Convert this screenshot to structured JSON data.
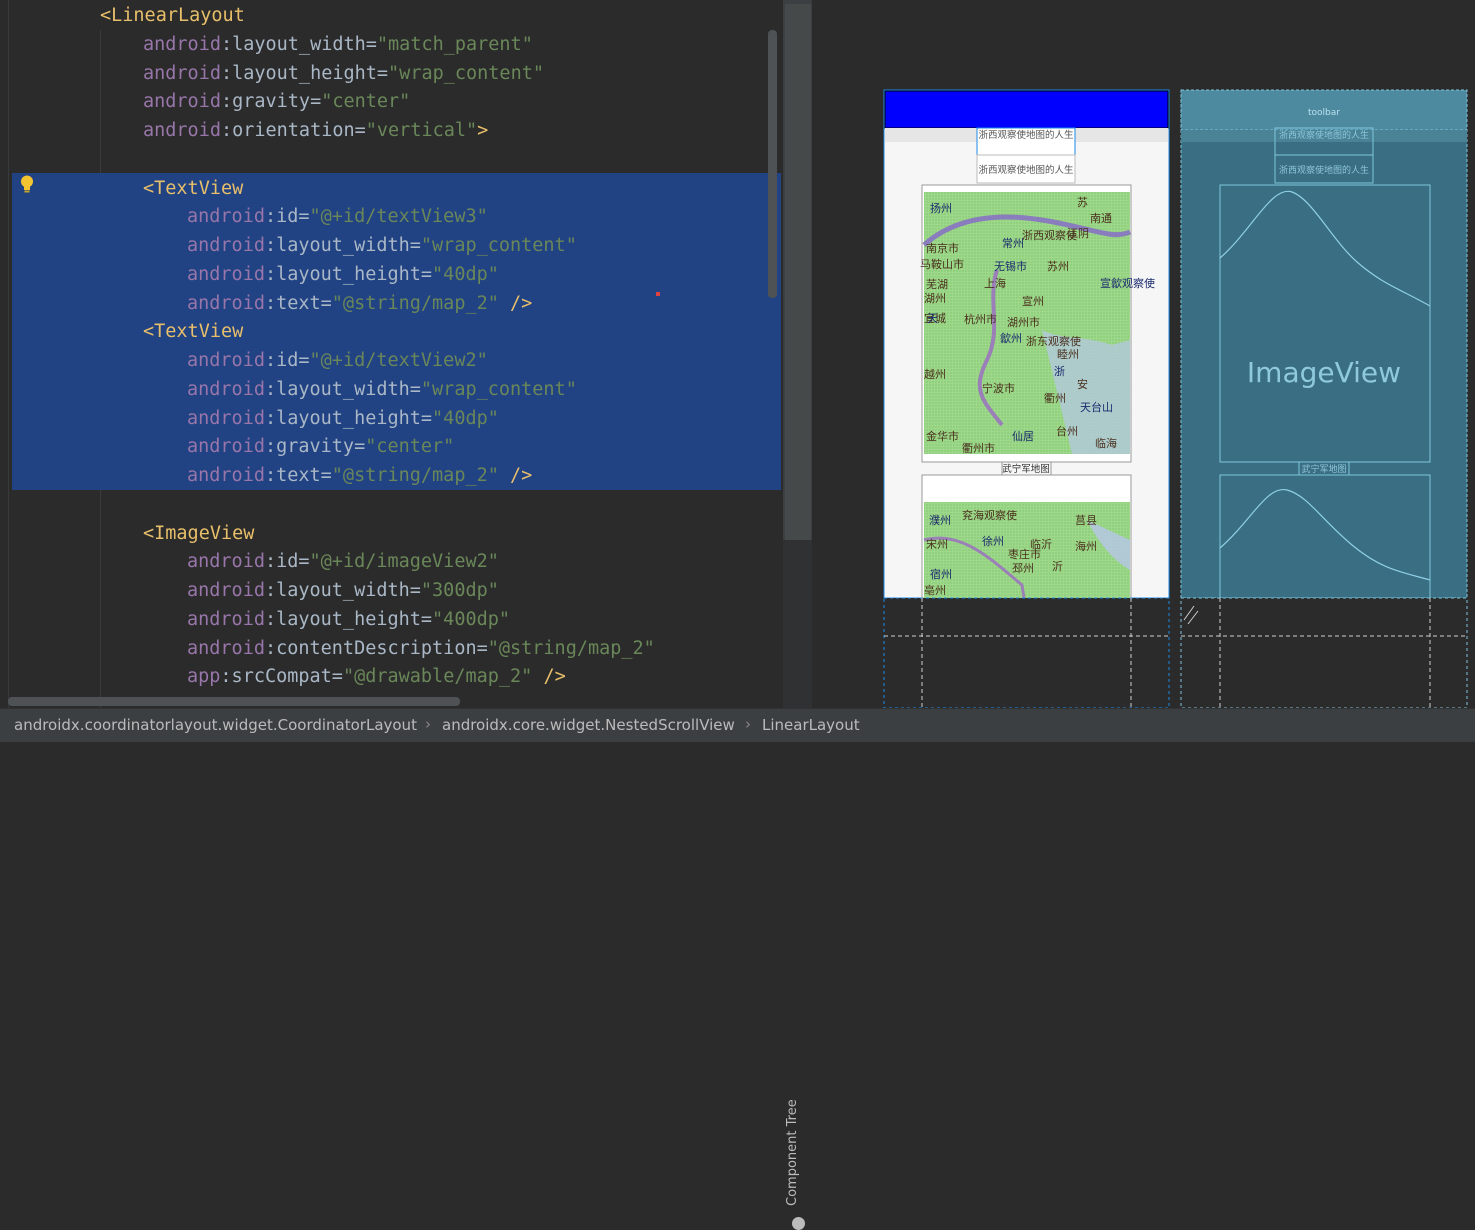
{
  "editor": {
    "lines": [
      {
        "indent": 0,
        "parts": [
          [
            "tag",
            "<LinearLayout"
          ]
        ]
      },
      {
        "indent": 1,
        "parts": [
          [
            "ns",
            "android"
          ],
          [
            "plain",
            ":layout_width="
          ],
          [
            "val",
            "\"match_parent\""
          ]
        ]
      },
      {
        "indent": 1,
        "parts": [
          [
            "ns",
            "android"
          ],
          [
            "plain",
            ":layout_height="
          ],
          [
            "val",
            "\"wrap_content\""
          ]
        ]
      },
      {
        "indent": 1,
        "parts": [
          [
            "ns",
            "android"
          ],
          [
            "plain",
            ":gravity="
          ],
          [
            "val",
            "\"center\""
          ]
        ]
      },
      {
        "indent": 1,
        "parts": [
          [
            "ns",
            "android"
          ],
          [
            "plain",
            ":orientation="
          ],
          [
            "val",
            "\"vertical\""
          ],
          [
            "tag",
            ">"
          ]
        ]
      },
      {
        "indent": 0,
        "parts": []
      },
      {
        "indent": 1,
        "parts": [
          [
            "tag",
            "<TextView"
          ]
        ]
      },
      {
        "indent": 2,
        "parts": [
          [
            "ns",
            "android"
          ],
          [
            "plain",
            ":id="
          ],
          [
            "val",
            "\"@+id/textView3\""
          ]
        ]
      },
      {
        "indent": 2,
        "parts": [
          [
            "ns",
            "android"
          ],
          [
            "plain",
            ":layout_width="
          ],
          [
            "val",
            "\"wrap_content\""
          ]
        ]
      },
      {
        "indent": 2,
        "parts": [
          [
            "ns",
            "android"
          ],
          [
            "plain",
            ":layout_height="
          ],
          [
            "val",
            "\"40dp\""
          ]
        ]
      },
      {
        "indent": 2,
        "parts": [
          [
            "ns",
            "android"
          ],
          [
            "plain",
            ":text="
          ],
          [
            "val",
            "\"@string/map_2\""
          ],
          [
            "tag",
            " />"
          ]
        ]
      },
      {
        "indent": 1,
        "parts": [
          [
            "tag",
            "<TextView"
          ]
        ]
      },
      {
        "indent": 2,
        "parts": [
          [
            "ns",
            "android"
          ],
          [
            "plain",
            ":id="
          ],
          [
            "val",
            "\"@+id/textView2\""
          ]
        ]
      },
      {
        "indent": 2,
        "parts": [
          [
            "ns",
            "android"
          ],
          [
            "plain",
            ":layout_width="
          ],
          [
            "val",
            "\"wrap_content\""
          ]
        ]
      },
      {
        "indent": 2,
        "parts": [
          [
            "ns",
            "android"
          ],
          [
            "plain",
            ":layout_height="
          ],
          [
            "val",
            "\"40dp\""
          ]
        ]
      },
      {
        "indent": 2,
        "parts": [
          [
            "ns",
            "android"
          ],
          [
            "plain",
            ":gravity="
          ],
          [
            "val",
            "\"center\""
          ]
        ]
      },
      {
        "indent": 2,
        "parts": [
          [
            "ns",
            "android"
          ],
          [
            "plain",
            ":text="
          ],
          [
            "val",
            "\"@string/map_2\""
          ],
          [
            "tag",
            " />"
          ]
        ]
      },
      {
        "indent": 0,
        "parts": []
      },
      {
        "indent": 1,
        "parts": [
          [
            "tag",
            "<ImageView"
          ]
        ]
      },
      {
        "indent": 2,
        "parts": [
          [
            "ns",
            "android"
          ],
          [
            "plain",
            ":id="
          ],
          [
            "val",
            "\"@+id/imageView2\""
          ]
        ]
      },
      {
        "indent": 2,
        "parts": [
          [
            "ns",
            "android"
          ],
          [
            "plain",
            ":layout_width="
          ],
          [
            "val",
            "\"300dp\""
          ]
        ]
      },
      {
        "indent": 2,
        "parts": [
          [
            "ns",
            "android"
          ],
          [
            "plain",
            ":layout_height="
          ],
          [
            "val",
            "\"400dp\""
          ]
        ]
      },
      {
        "indent": 2,
        "parts": [
          [
            "ns",
            "android"
          ],
          [
            "plain",
            ":contentDescription="
          ],
          [
            "val",
            "\"@string/map_2\""
          ]
        ]
      },
      {
        "indent": 2,
        "parts": [
          [
            "ns",
            "app"
          ],
          [
            "plain",
            ":srcCompat="
          ],
          [
            "val",
            "\"@drawable/map_2\""
          ],
          [
            "tag",
            " />"
          ]
        ]
      }
    ]
  },
  "side_panel": {
    "component_tree_label": "Component Tree"
  },
  "design": {
    "text1": "浙西观察使地图的人生",
    "text2": "浙西观察使地图的人生",
    "caption": "武宁军地图",
    "map_labels_1": [
      "扬州",
      "苏",
      "南通",
      "南京市",
      "常州",
      "浙西观察使",
      "江阴",
      "马鞍山市",
      "无锡市",
      "苏州",
      "芜湖",
      "上海",
      "宣歙观察使",
      "湖州",
      "宣州",
      "宜城",
      "天",
      "湖州市",
      "杭州市",
      "浙东观察使",
      "歙州",
      "睦州",
      "越州",
      "宁波市",
      "浙",
      "安",
      "衢州",
      "金华市",
      "仙居",
      "台州",
      "临海",
      "衢州市",
      "天台山"
    ],
    "map_labels_2": [
      "濮州",
      "兖海观察使",
      "莒县",
      "宋州",
      "徐州",
      "海州",
      "临沂",
      "枣庄市",
      "宿州",
      "沂",
      "亳州",
      "邳州"
    ]
  },
  "blueprint": {
    "toolbar_label": "toolbar",
    "imageview_label": "ImageView",
    "text1": "浙西观察使地图的人生",
    "text2": "浙西观察使地图的人生",
    "caption": "武宁军地图"
  },
  "breadcrumb": {
    "items": [
      "androidx.coordinatorlayout.widget.CoordinatorLayout",
      "androidx.core.widget.NestedScrollView",
      "LinearLayout"
    ],
    "separator": "›"
  },
  "colors": {
    "editor_bg": "#2b2b2b",
    "selection": "#214283",
    "tag": "#e8bf6a",
    "attr_ns": "#9876aa",
    "value": "#6a8759",
    "toolbar_blue": "#0000ff",
    "blueprint_bg": "#3a6e82"
  }
}
